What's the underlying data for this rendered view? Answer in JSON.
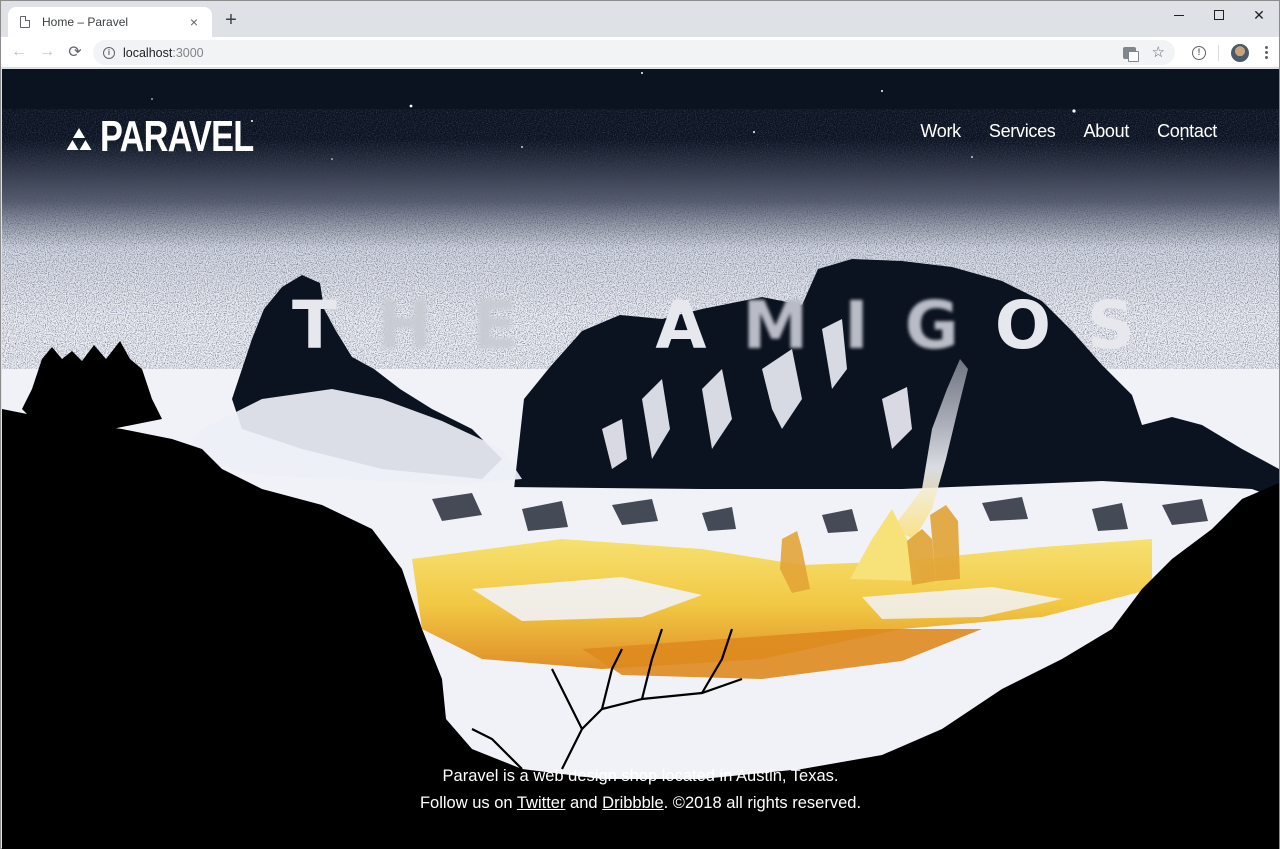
{
  "browser": {
    "tab_title": "Home – Paravel",
    "tab_close_glyph": "×",
    "new_tab_glyph": "+",
    "url_host": "localhost",
    "url_port": ":3000",
    "back_glyph": "←",
    "forward_glyph": "→",
    "reload_glyph": "⟳",
    "star_glyph": "☆",
    "close_glyph": "✕",
    "info_glyph": "i",
    "ext_glyph": "!"
  },
  "site": {
    "logo_text": "PARAVEL",
    "nav": [
      {
        "label": "Work"
      },
      {
        "label": "Services"
      },
      {
        "label": "About"
      },
      {
        "label": "Contact"
      }
    ],
    "hero": {
      "word1_sharp": "T",
      "word1_blur": "HE",
      "word2_sharp": "A",
      "word2_blur": "MIG",
      "word2_end": "OS"
    },
    "footer": {
      "line1": "Paravel is a web design shop located in Austin, Texas.",
      "line2_prefix": "Follow us on ",
      "twitter_label": "Twitter",
      "line2_mid": " and ",
      "dribbble_label": "Dribbble",
      "line2_suffix": ". ©2018 all rights reserved."
    },
    "colors": {
      "night_sky": "#0b1220",
      "snow": "#eef0f7",
      "fire_yellow": "#f5d84a",
      "fire_orange": "#e08a1c",
      "silhouette": "#000000"
    }
  }
}
